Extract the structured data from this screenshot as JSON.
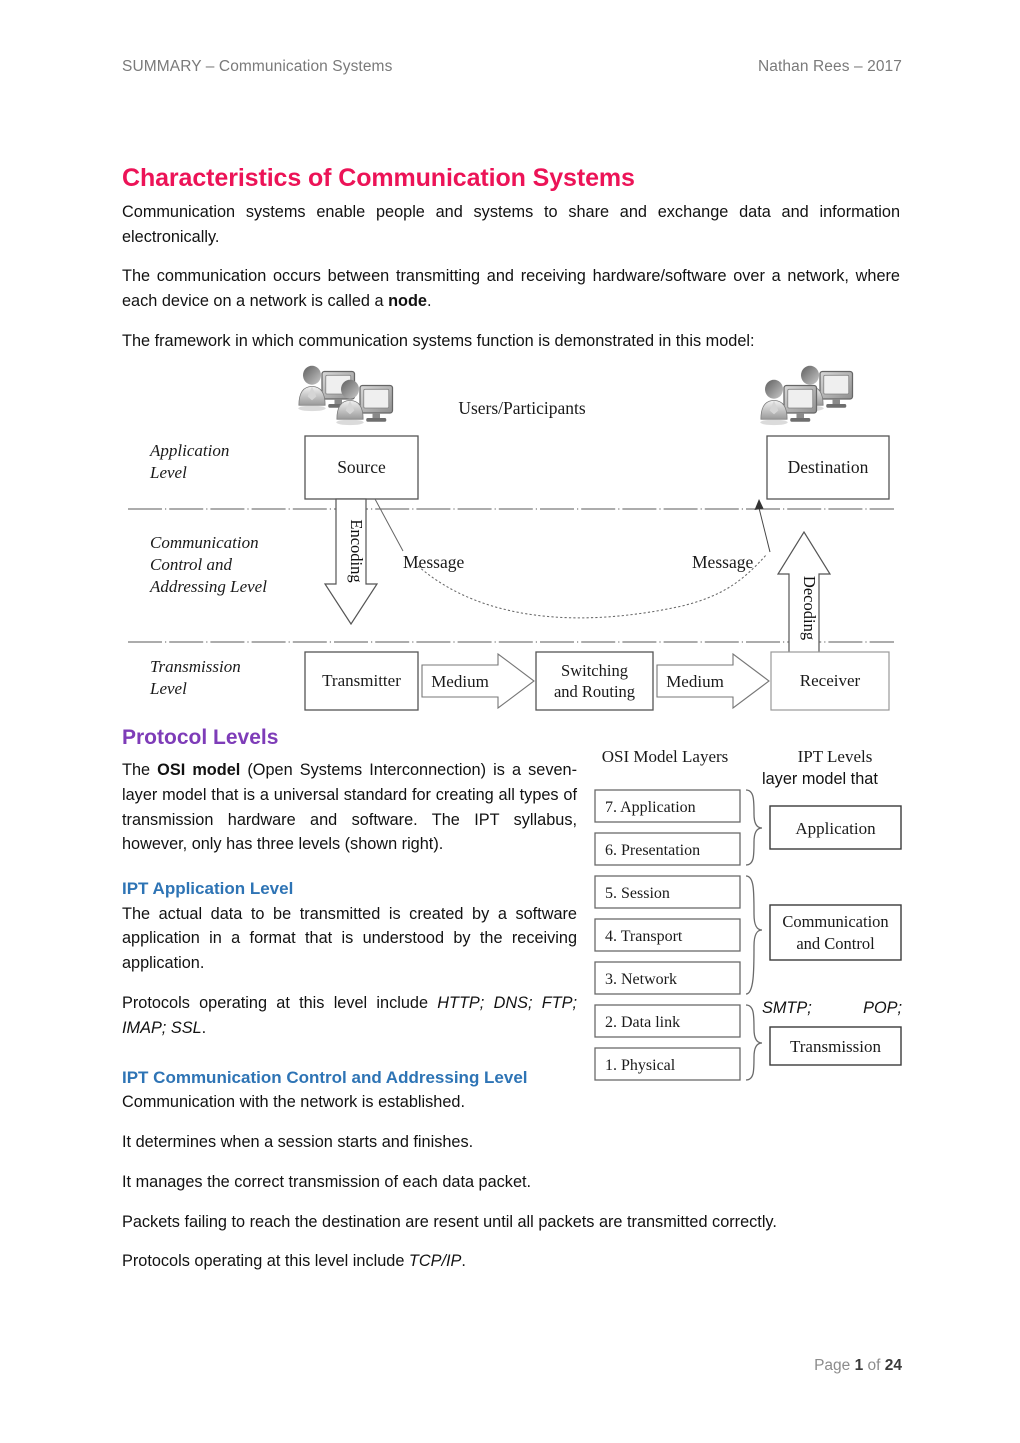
{
  "header": {
    "left": "SUMMARY – Communication Systems",
    "right": "Nathan Rees – 2017"
  },
  "footer": {
    "prefix": "Page ",
    "page": "1",
    "middle": " of ",
    "total": "24"
  },
  "title": "Characteristics of Communication Systems",
  "intro": {
    "p1": "Communication systems enable people and systems to share and exchange data and information electronically.",
    "p2_a": "The communication occurs between transmitting and receiving hardware/software over a network, where each device on a network is called a ",
    "p2_bold": "node",
    "p2_b": ".",
    "p3": "The framework in which communication systems function is demonstrated in this model:"
  },
  "model_figure": {
    "users_label": "Users/Participants",
    "level_labels": [
      "Application\nLevel",
      "Communication\nControl and\nAddressing Level",
      "Transmission\nLevel"
    ],
    "level_application_l1": "Application",
    "level_application_l2": "Level",
    "level_comm_l1": "Communication",
    "level_comm_l2": "Control and",
    "level_comm_l3": "Addressing Level",
    "level_trans_l1": "Transmission",
    "level_trans_l2": "Level",
    "source": "Source",
    "destination": "Destination",
    "encoding": "Encoding",
    "decoding": "Decoding",
    "message_left": "Message",
    "message_right": "Message",
    "transmitter": "Transmitter",
    "medium_left": "Medium",
    "switching_l1": "Switching",
    "switching_l2": "and Routing",
    "medium_right": "Medium",
    "receiver": "Receiver"
  },
  "protocol": {
    "heading": "Protocol Levels",
    "p1_a": "The ",
    "p1_bold": "OSI model",
    "p1_b": " (Open Systems Interconnection) is a seven-layer model that is a universal standard for creating all types of transmission hardware and software. The IPT syllabus, however, only has three levels (shown right).",
    "p1_wrap_fragment": "layer model that",
    "p1_main": "The OSI model (Open Systems Interconnection) is a seven-"
  },
  "app_level": {
    "heading": "IPT Application Level",
    "p1": "The actual data to be transmitted is created by a software application in a format that is understood by the receiving application.",
    "p2_a": "Protocols operating at this level include ",
    "p2_italic": "HTTP; DNS; FTP; IMAP; SSL",
    "p2_b": ".",
    "wrap_smtp": "SMTP;",
    "wrap_pop": "POP;"
  },
  "comm_level": {
    "heading": "IPT Communication Control and Addressing Level",
    "p1": "Communication with the network is established.",
    "p2": "It determines when a session starts and finishes.",
    "p3": "It manages the correct transmission of each data packet.",
    "p4": "Packets failing to reach the destination are resent until all packets are transmitted correctly.",
    "p5_a": "Protocols operating at this level include ",
    "p5_italic": "TCP/IP",
    "p5_b": "."
  },
  "osi_figure": {
    "col1_title": "OSI Model Layers",
    "col2_title": "IPT Levels",
    "layers": [
      "7. Application",
      "6. Presentation",
      "5. Session",
      "4. Transport",
      "3. Network",
      "2. Data link",
      "1. Physical"
    ],
    "ipt_levels": [
      "Application",
      "Communication and Control",
      "Transmission"
    ],
    "ipt_level_2_l1": "Communication",
    "ipt_level_2_l2": "and Control"
  },
  "colors": {
    "title_pink": "#ec1357",
    "section_purple": "#7e3cb8",
    "sub_blue": "#2e74b5",
    "header_gray": "#7a7a7a",
    "body_text": "#121212",
    "figure_line": "#555555"
  }
}
